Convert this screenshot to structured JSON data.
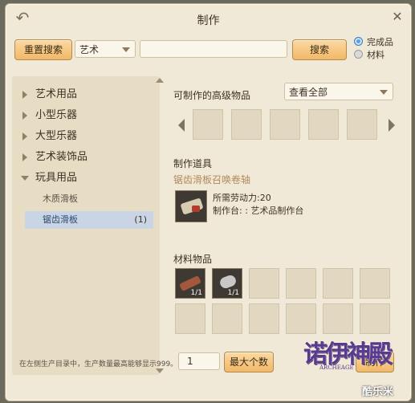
{
  "window": {
    "title": "制作"
  },
  "toolbar": {
    "reset_label": "重置搜索",
    "category_value": "艺术",
    "search_placeholder": "",
    "search_label": "搜索"
  },
  "filter": {
    "options": [
      "完成品",
      "材料"
    ],
    "selected": "完成品"
  },
  "tree": {
    "categories": [
      "艺术用品",
      "小型乐器",
      "大型乐器",
      "艺术装饰品",
      "玩具用品"
    ],
    "expanded": "玩具用品",
    "subitems": [
      {
        "label": "木质滑板",
        "count": ""
      },
      {
        "label": "锯齿滑板",
        "count": "(1)"
      }
    ],
    "selected_subitem": "锯齿滑板"
  },
  "craftable": {
    "label": "可制作的高级物品",
    "filter_value": "查看全部"
  },
  "tool": {
    "label": "制作道具",
    "recipe_name": "锯齿滑板召唤卷轴",
    "labor": "所需劳动力:20",
    "station": "制作台: : 艺术品制作台"
  },
  "materials": {
    "label": "材料物品",
    "items": [
      {
        "name": "plank-icon",
        "qty": "1/1"
      },
      {
        "name": "wheel-icon",
        "qty": "1/1"
      }
    ]
  },
  "bottom": {
    "quantity": "1",
    "max_label": "最大个数",
    "craft_label": "制作",
    "note": "在左侧生产目录中，生产数量最高能够显示999。"
  },
  "overlay": {
    "logo_main": "诺伊神殿",
    "logo_sub": "ARCHEAGE",
    "watermark": "酷乐米"
  },
  "colors": {
    "accent_button": "#f1b868",
    "selected_row": "#c9d4e4",
    "recipe_name": "#b38a5a"
  }
}
